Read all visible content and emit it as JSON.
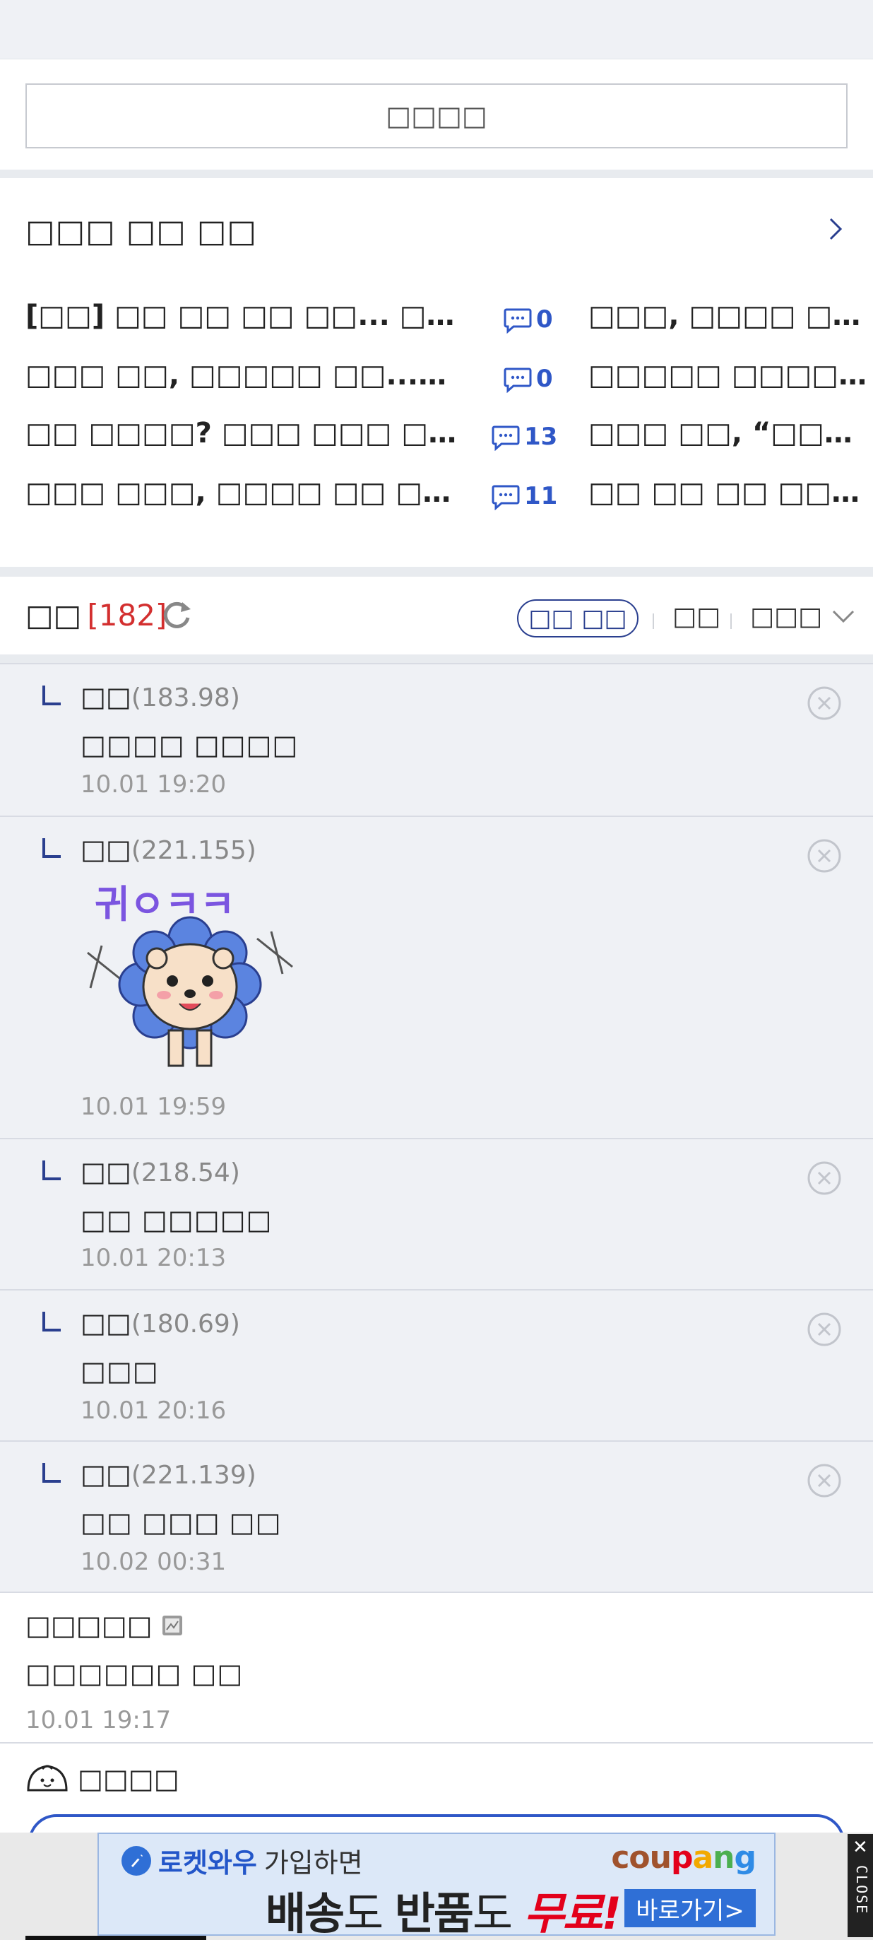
{
  "top_button": {
    "label": "□□□□"
  },
  "hot_news": {
    "title": "□□□ □□ □□",
    "rows": [
      {
        "left": "[□□] □□ □□ □□ □□... □□□ □...",
        "count": "0",
        "right": "□□□, □□□□ □□□.."
      },
      {
        "left": "□□□ □□, □□□□□ □□...□□□ ...",
        "count": "0",
        "right": "□□□□□ □□□□ □□"
      },
      {
        "left": "□□ □□□□? □□□ □□□ □□□ □...",
        "count": "13",
        "right": "□□□ □□, “□□□ □□"
      },
      {
        "left": "□□□ □□□, □□□□ □□ □□ □ □...",
        "count": "11",
        "right": "□□ □□ □□ □□□ □□"
      }
    ]
  },
  "comments_header": {
    "label": "□□",
    "count": "[182]",
    "pill": "□□ □□",
    "sort1": "□□",
    "sort2": "□□□"
  },
  "replies": [
    {
      "author": "□□",
      "ip": "(183.98)",
      "text": "□□□□ □□□□",
      "time": "10.01 19:20",
      "sticker": false
    },
    {
      "author": "□□",
      "ip": "(221.155)",
      "text": "",
      "time": "10.01 19:59",
      "sticker": true,
      "sticker_text": "귀ㅇㅋㅋ"
    },
    {
      "author": "□□",
      "ip": "(218.54)",
      "text": "□□ □□□□□",
      "time": "10.01 20:13",
      "sticker": false
    },
    {
      "author": "□□",
      "ip": "(180.69)",
      "text": "□□□",
      "time": "10.01 20:16",
      "sticker": false
    },
    {
      "author": "□□",
      "ip": "(221.139)",
      "text": "□□ □□□ □□",
      "time": "10.02 00:31",
      "sticker": false
    }
  ],
  "plain_comment": {
    "author": "□□□□□",
    "text": "□□□□□□ □□",
    "time": "10.01 19:17"
  },
  "write": {
    "label": "□□□□"
  },
  "ad": {
    "line1_bold": "로켓와우",
    "line1_sub": "가입하면",
    "brand": "coupang",
    "line2_a": "배송",
    "line2_b": "도 ",
    "line2_c": "반품",
    "line2_d": "도 ",
    "line2_e": "무료!",
    "cta": "바로가기>",
    "close_x": "✕",
    "close_word": "CLOSE"
  },
  "colors": {
    "accent": "#2a3f8f",
    "count_blue": "#2f57c7",
    "count_red": "#d32f2f",
    "reply_bg": "#eff1f5",
    "ad_red": "#e3001b"
  },
  "icons": [
    "chevron-right-icon",
    "comment-bubble-icon",
    "refresh-icon",
    "chevron-down-icon",
    "reply-arrow-icon",
    "close-circle-icon",
    "image-attachment-icon",
    "dumpling-icon",
    "rocket-icon"
  ]
}
